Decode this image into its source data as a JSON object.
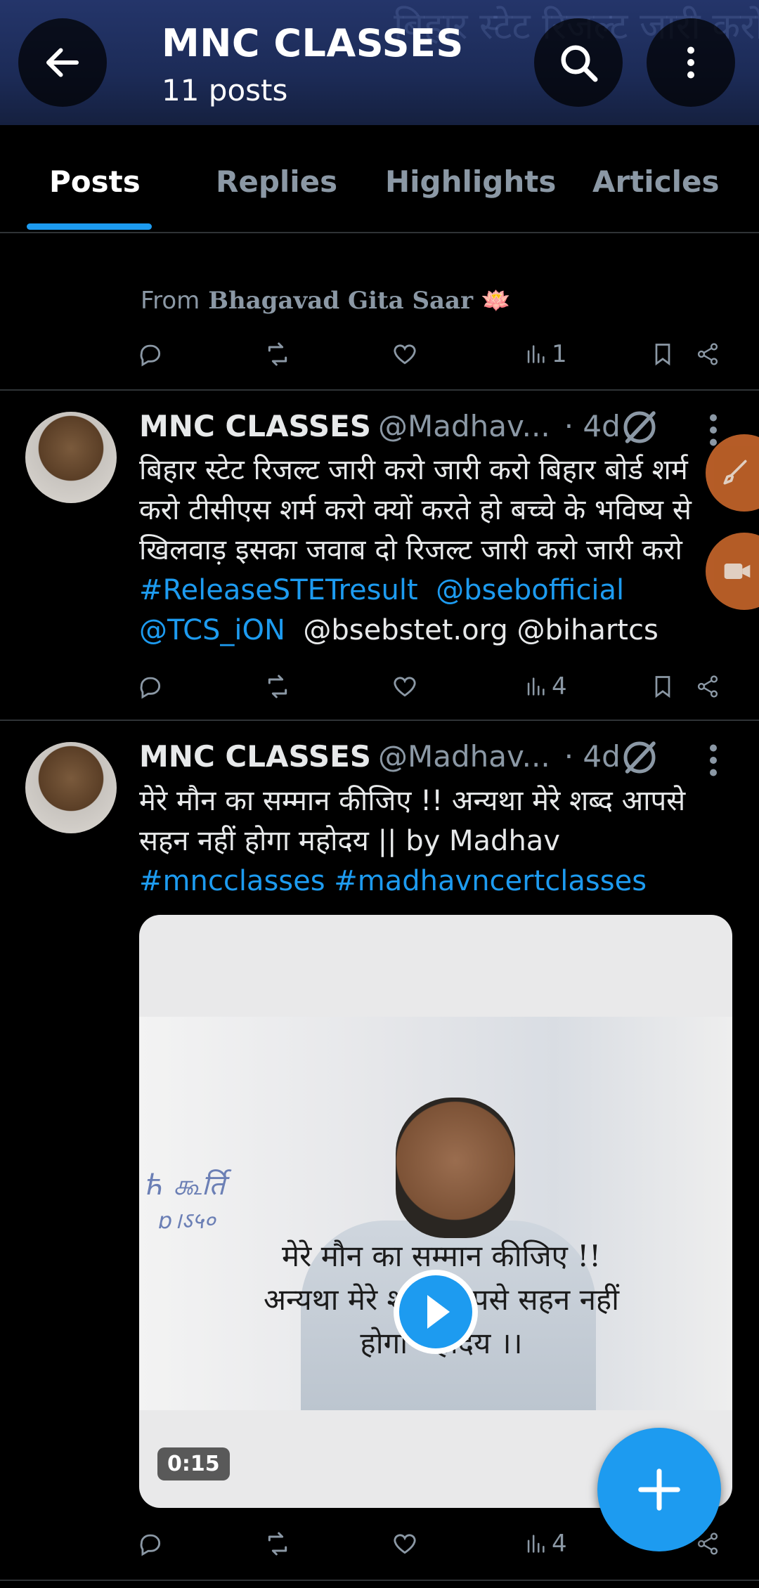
{
  "header": {
    "title": "MNC CLASSES",
    "subtitle": "11 posts",
    "banner_text": "बिहार स्टेट रिजल्ट जारी करो"
  },
  "tabs": [
    {
      "label": "Posts",
      "active": true
    },
    {
      "label": "Replies",
      "active": false
    },
    {
      "label": "Highlights",
      "active": false
    },
    {
      "label": "Articles",
      "active": false
    }
  ],
  "post0": {
    "from_label": "From",
    "from_source": "Bhagavad Gita Saar 🪷",
    "views": "1"
  },
  "post1": {
    "name": "MNC CLASSES",
    "handle": "@Madhav...",
    "time": "· 4d",
    "text": "बिहार स्टेट रिजल्ट जारी करो जारी करो बिहार बोर्ड शर्म करो टीसीएस शर्म करो क्यों करते हो बच्चे के भविष्य से खिलवाड़ इसका जवाब दो रिजल्ट जारी करो जारी करो",
    "hashtag": "#ReleaseSTETresult",
    "mention1": "@bsebofficial",
    "mention2": "@TCS_iON",
    "plain_mentions": "@bsebstet.org @bihartcs",
    "views": "4"
  },
  "post2": {
    "name": "MNC CLASSES",
    "handle": "@Madhav...",
    "time": "· 4d",
    "text": "मेरे मौन का सम्मान कीजिए !! अन्यथा मेरे शब्द आपसे सहन नहीं होगा महोदय || by Madhav",
    "hashtags": "#mncclasses #madhavncertclasses",
    "video_overlay_text": "मेरे मौन का सम्मान कीजिए !! अन्यथा मेरे शब्द आपसे सहन नहीं होगा महोदय ।।",
    "video_duration": "0:15",
    "views": "4"
  },
  "colors": {
    "accent": "#1d9bf0",
    "background": "#000000",
    "muted": "#8b98a5",
    "side_button": "#c4642a"
  }
}
